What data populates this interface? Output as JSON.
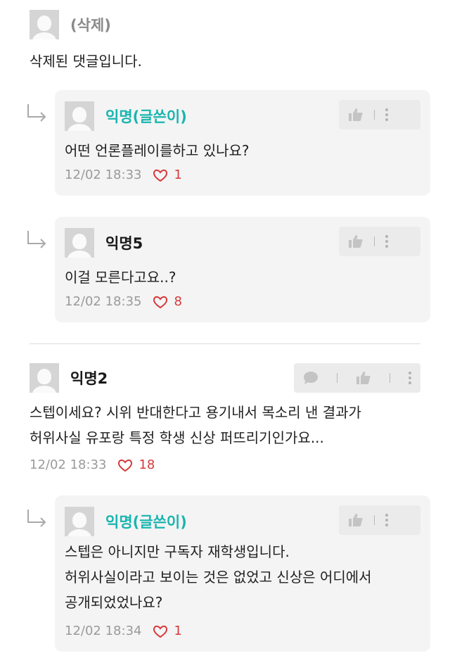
{
  "comments": [
    {
      "author": "(삭제)",
      "text": "삭제된 댓글입니다."
    },
    {
      "author": "익명(글쓴이)",
      "text": "어떤 언론플레이를하고 있나요?",
      "time": "12/02 18:33",
      "likes": "1"
    },
    {
      "author": "익명5",
      "text": "이걸 모른다고요..?",
      "time": "12/02 18:35",
      "likes": "8"
    },
    {
      "author": "익명2",
      "lines": [
        "스텝이세요? 시위 반대한다고 용기내서 목소리 낸 결과가",
        "허위사실 유포랑 특정 학생 신상 퍼뜨리기인가요..."
      ],
      "time": "12/02 18:33",
      "likes": "18"
    },
    {
      "author": "익명(글쓴이)",
      "lines": [
        "스텝은 아니지만 구독자 재학생입니다.",
        "허위사실이라고 보이는 것은 없었고 신상은 어디에서",
        "공개되었었나요?"
      ],
      "time": "12/02 18:34",
      "likes": "1"
    }
  ],
  "icons": {
    "reply": "reply-arrow-icon",
    "like": "heart-outline-icon",
    "thumb": "thumbs-up-icon",
    "more": "more-vertical-icon",
    "message": "chat-bubble-icon"
  },
  "colors": {
    "op_author": "#19b5b0",
    "like_red": "#d73a3a",
    "reply_bg": "#f4f4f4",
    "avatar": "#d5d5d5"
  }
}
